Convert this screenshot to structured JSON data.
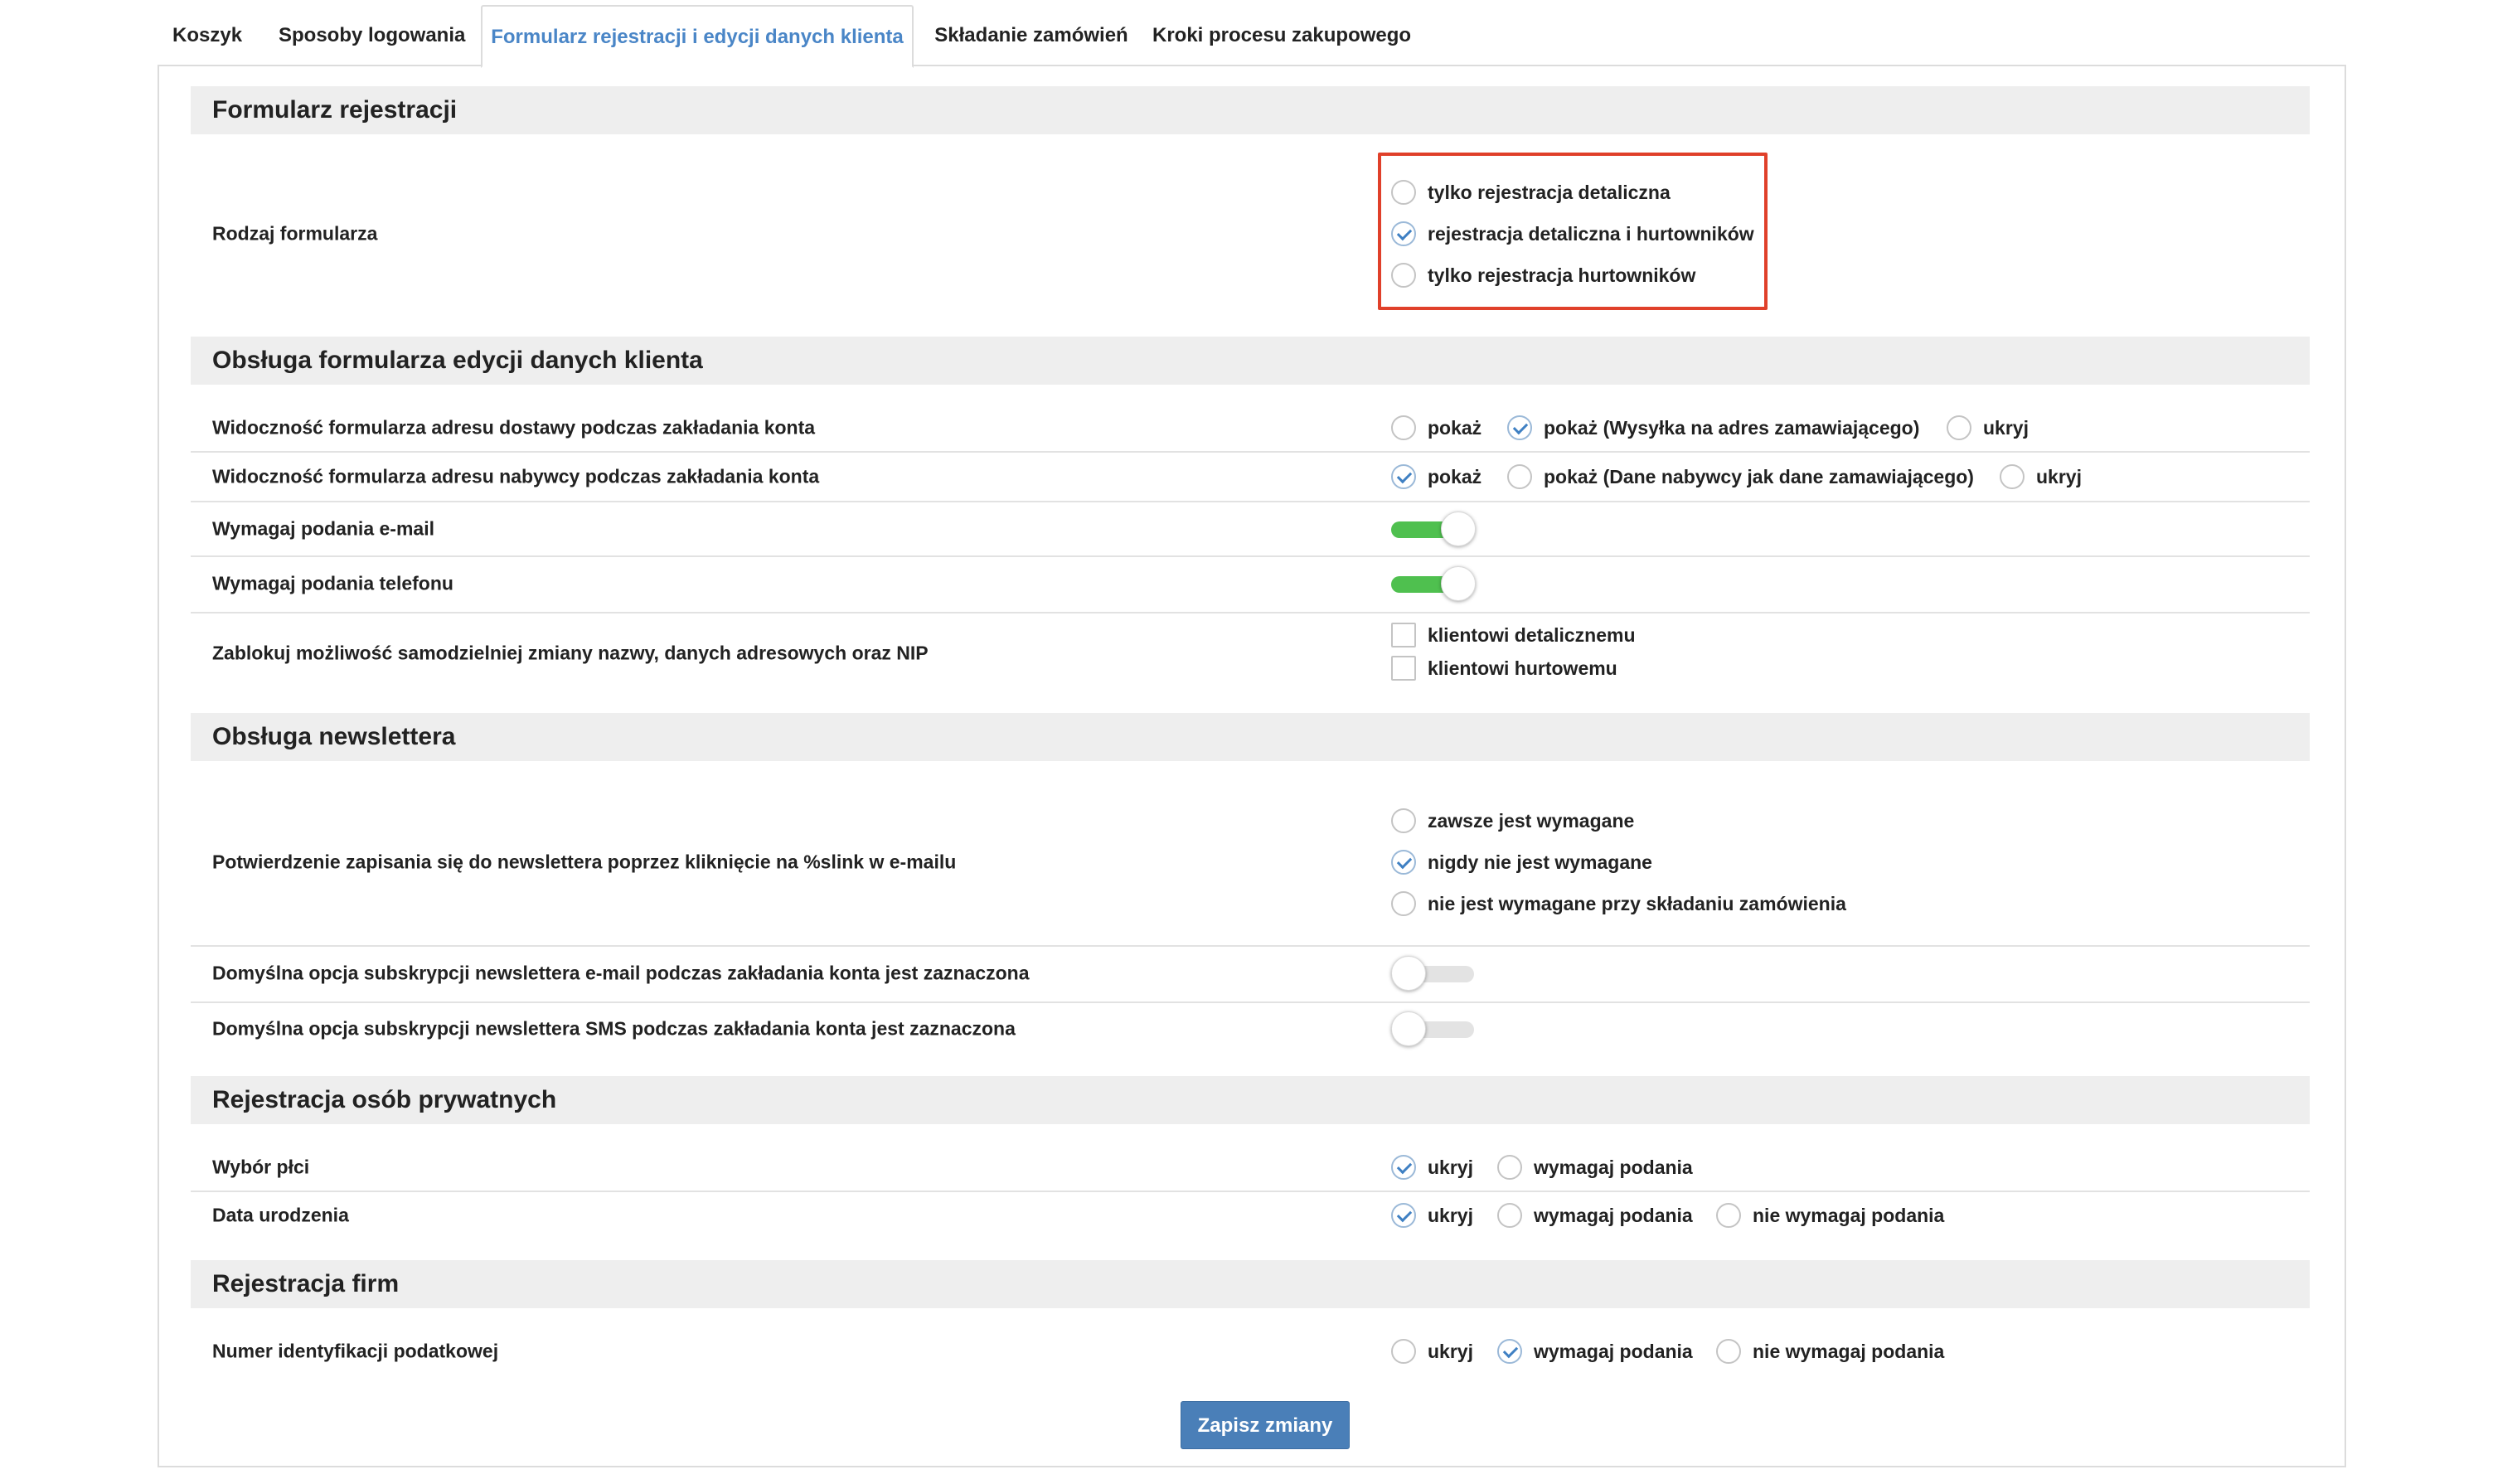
{
  "tabs": [
    {
      "label": "Koszyk"
    },
    {
      "label": "Sposoby logowania"
    },
    {
      "label": "Formularz rejestracji i edycji danych klienta",
      "active": true
    },
    {
      "label": "Składanie zamówień"
    },
    {
      "label": "Kroki procesu zakupowego"
    }
  ],
  "sections": {
    "registration_form": {
      "title": "Formularz rejestracji",
      "form_type": {
        "label": "Rodzaj formularza",
        "options": [
          "tylko rejestracja detaliczna",
          "rejestracja detaliczna i hurtowników",
          "tylko rejestracja hurtowników"
        ],
        "selected": "rejestracja detaliczna i hurtowników"
      }
    },
    "edit_form": {
      "title": "Obsługa formularza edycji danych klienta",
      "delivery_address_visibility": {
        "label": "Widoczność formularza adresu dostawy podczas zakładania konta",
        "options": [
          "pokaż",
          "pokaż (Wysyłka na adres zamawiającego)",
          "ukryj"
        ],
        "selected": "pokaż (Wysyłka na adres zamawiającego)"
      },
      "buyer_address_visibility": {
        "label": "Widoczność formularza adresu nabywcy podczas zakładania konta",
        "options": [
          "pokaż",
          "pokaż (Dane nabywcy jak dane zamawiającego)",
          "ukryj"
        ],
        "selected": "pokaż"
      },
      "require_email": {
        "label": "Wymagaj podania e-mail",
        "enabled": true
      },
      "require_phone": {
        "label": "Wymagaj podania telefonu",
        "enabled": true
      },
      "lock_changes": {
        "label": "Zablokuj możliwość samodzielniej zmiany nazwy, danych adresowych oraz NIP",
        "options": [
          {
            "label": "klientowi detalicznemu",
            "checked": false
          },
          {
            "label": "klientowi hurtowemu",
            "checked": false
          }
        ]
      }
    },
    "newsletter": {
      "title": "Obsługa newslettera",
      "confirmation": {
        "label": "Potwierdzenie zapisania się do newslettera poprzez kliknięcie na %slink w e-mailu",
        "options": [
          "zawsze jest wymagane",
          "nigdy nie jest wymagane",
          "nie jest wymagane przy składaniu zamówienia"
        ],
        "selected": "nigdy nie jest wymagane"
      },
      "default_email_sub": {
        "label": "Domyślna opcja subskrypcji newslettera e-mail podczas zakładania konta jest zaznaczona",
        "enabled": false
      },
      "default_sms_sub": {
        "label": "Domyślna opcja subskrypcji newslettera SMS podczas zakładania konta jest zaznaczona",
        "enabled": false
      }
    },
    "private_registration": {
      "title": "Rejestracja osób prywatnych",
      "gender": {
        "label": "Wybór płci",
        "options": [
          "ukryj",
          "wymagaj podania"
        ],
        "selected": "ukryj"
      },
      "birth_date": {
        "label": "Data urodzenia",
        "options": [
          "ukryj",
          "wymagaj podania",
          "nie wymagaj podania"
        ],
        "selected": "ukryj"
      }
    },
    "company_registration": {
      "title": "Rejestracja firm",
      "tax_id": {
        "label": "Numer identyfikacji podatkowej",
        "options": [
          "ukryj",
          "wymagaj podania",
          "nie wymagaj podania"
        ],
        "selected": "wymagaj podania"
      }
    }
  },
  "save_button": "Zapisz zmiany",
  "colors": {
    "accent": "#4a86c7",
    "toggle_on": "#4fc04f",
    "highlight": "#e0402a",
    "button": "#4a7fb8"
  }
}
